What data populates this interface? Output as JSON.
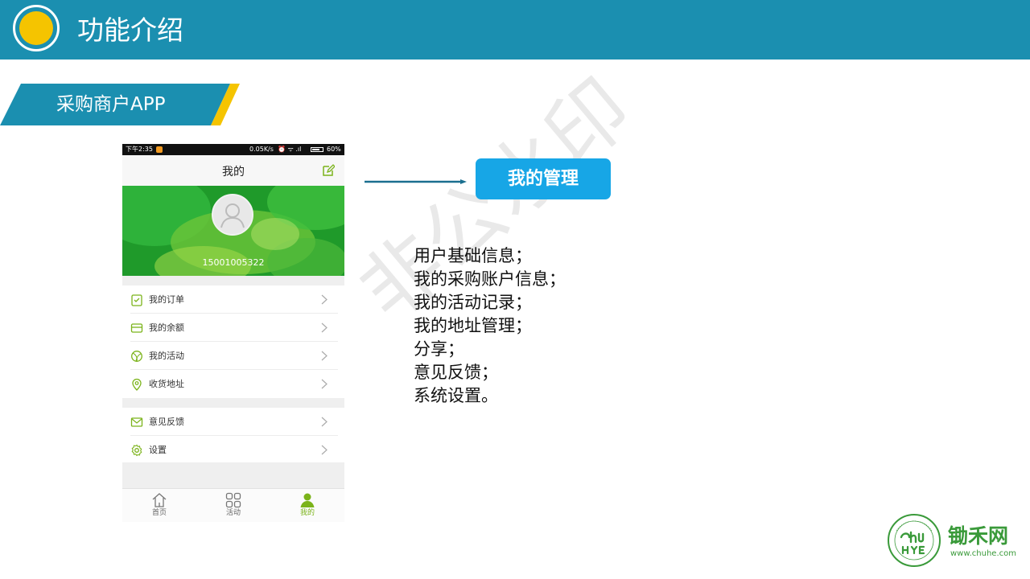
{
  "header": {
    "title": "功能介绍"
  },
  "section": {
    "tag": "采购商户APP"
  },
  "phone": {
    "status": {
      "time": "下午2:35",
      "speed": "0.05K/s",
      "battery": "60%"
    },
    "appbar_title": "我的",
    "phone_number": "15001005322",
    "menu_group1": [
      {
        "label": "我的订单",
        "icon": "clipboard-icon"
      },
      {
        "label": "我的余额",
        "icon": "wallet-icon"
      },
      {
        "label": "我的活动",
        "icon": "ball-icon"
      },
      {
        "label": "收货地址",
        "icon": "location-pin-icon"
      }
    ],
    "menu_group2": [
      {
        "label": "意见反馈",
        "icon": "mail-icon"
      },
      {
        "label": "设置",
        "icon": "gear-icon"
      }
    ],
    "tabs": [
      {
        "label": "首页",
        "icon": "home-icon"
      },
      {
        "label": "活动",
        "icon": "grid-icon"
      },
      {
        "label": "我的",
        "icon": "person-icon",
        "active": true
      }
    ]
  },
  "callout": {
    "label": "我的管理"
  },
  "features": [
    "用户基础信息；",
    "我的采购账户信息；",
    "我的活动记录；",
    "我的地址管理；",
    "分享；",
    "意见反馈；",
    "系统设置。"
  ],
  "watermark": "非公水印",
  "logo": {
    "brand": "锄禾网",
    "url": "www.chuhe.com",
    "mark_text": "CHUHE MEANS ORGANIC",
    "mark_since": "SINCE 2008"
  },
  "colors": {
    "banner": "#1b8fb0",
    "accent_yellow": "#f5c400",
    "badge": "#17a6e6",
    "app_green": "#7bb31a",
    "logo_green": "#3a9a3a"
  }
}
